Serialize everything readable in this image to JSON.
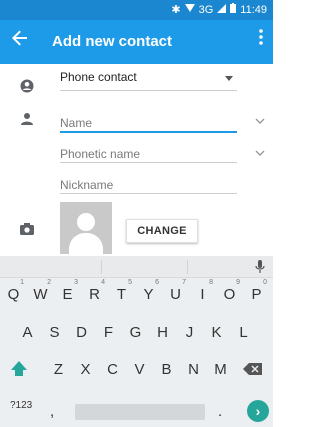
{
  "status_bar": {
    "bluetooth": "✱",
    "network": "3G",
    "time": "11:49"
  },
  "app_bar": {
    "title": "Add new contact",
    "back_icon": "arrow-left-icon",
    "menu_icon": "more-vert-icon"
  },
  "form": {
    "account": "Phone contact",
    "name_placeholder": "Name",
    "phonetic_placeholder": "Phonetic name",
    "nickname_placeholder": "Nickname",
    "change_label": "CHANGE"
  },
  "keyboard": {
    "row1": [
      {
        "key": "Q",
        "hint": "1"
      },
      {
        "key": "W",
        "hint": "2"
      },
      {
        "key": "E",
        "hint": "3"
      },
      {
        "key": "R",
        "hint": "4"
      },
      {
        "key": "T",
        "hint": "5"
      },
      {
        "key": "Y",
        "hint": "6"
      },
      {
        "key": "U",
        "hint": "7"
      },
      {
        "key": "I",
        "hint": "8"
      },
      {
        "key": "O",
        "hint": "9"
      },
      {
        "key": "P",
        "hint": "0"
      }
    ],
    "row2": [
      "A",
      "S",
      "D",
      "F",
      "G",
      "H",
      "J",
      "K",
      "L"
    ],
    "row3": [
      "Z",
      "X",
      "C",
      "V",
      "B",
      "N",
      "M"
    ],
    "symbols_label": "?123",
    "comma": ",",
    "period": ".",
    "enter": "›"
  },
  "colors": {
    "status_bar": "#1a87d0",
    "app_bar": "#1e9be8",
    "accent": "#1e9be8",
    "enter_key": "#26a69a"
  }
}
